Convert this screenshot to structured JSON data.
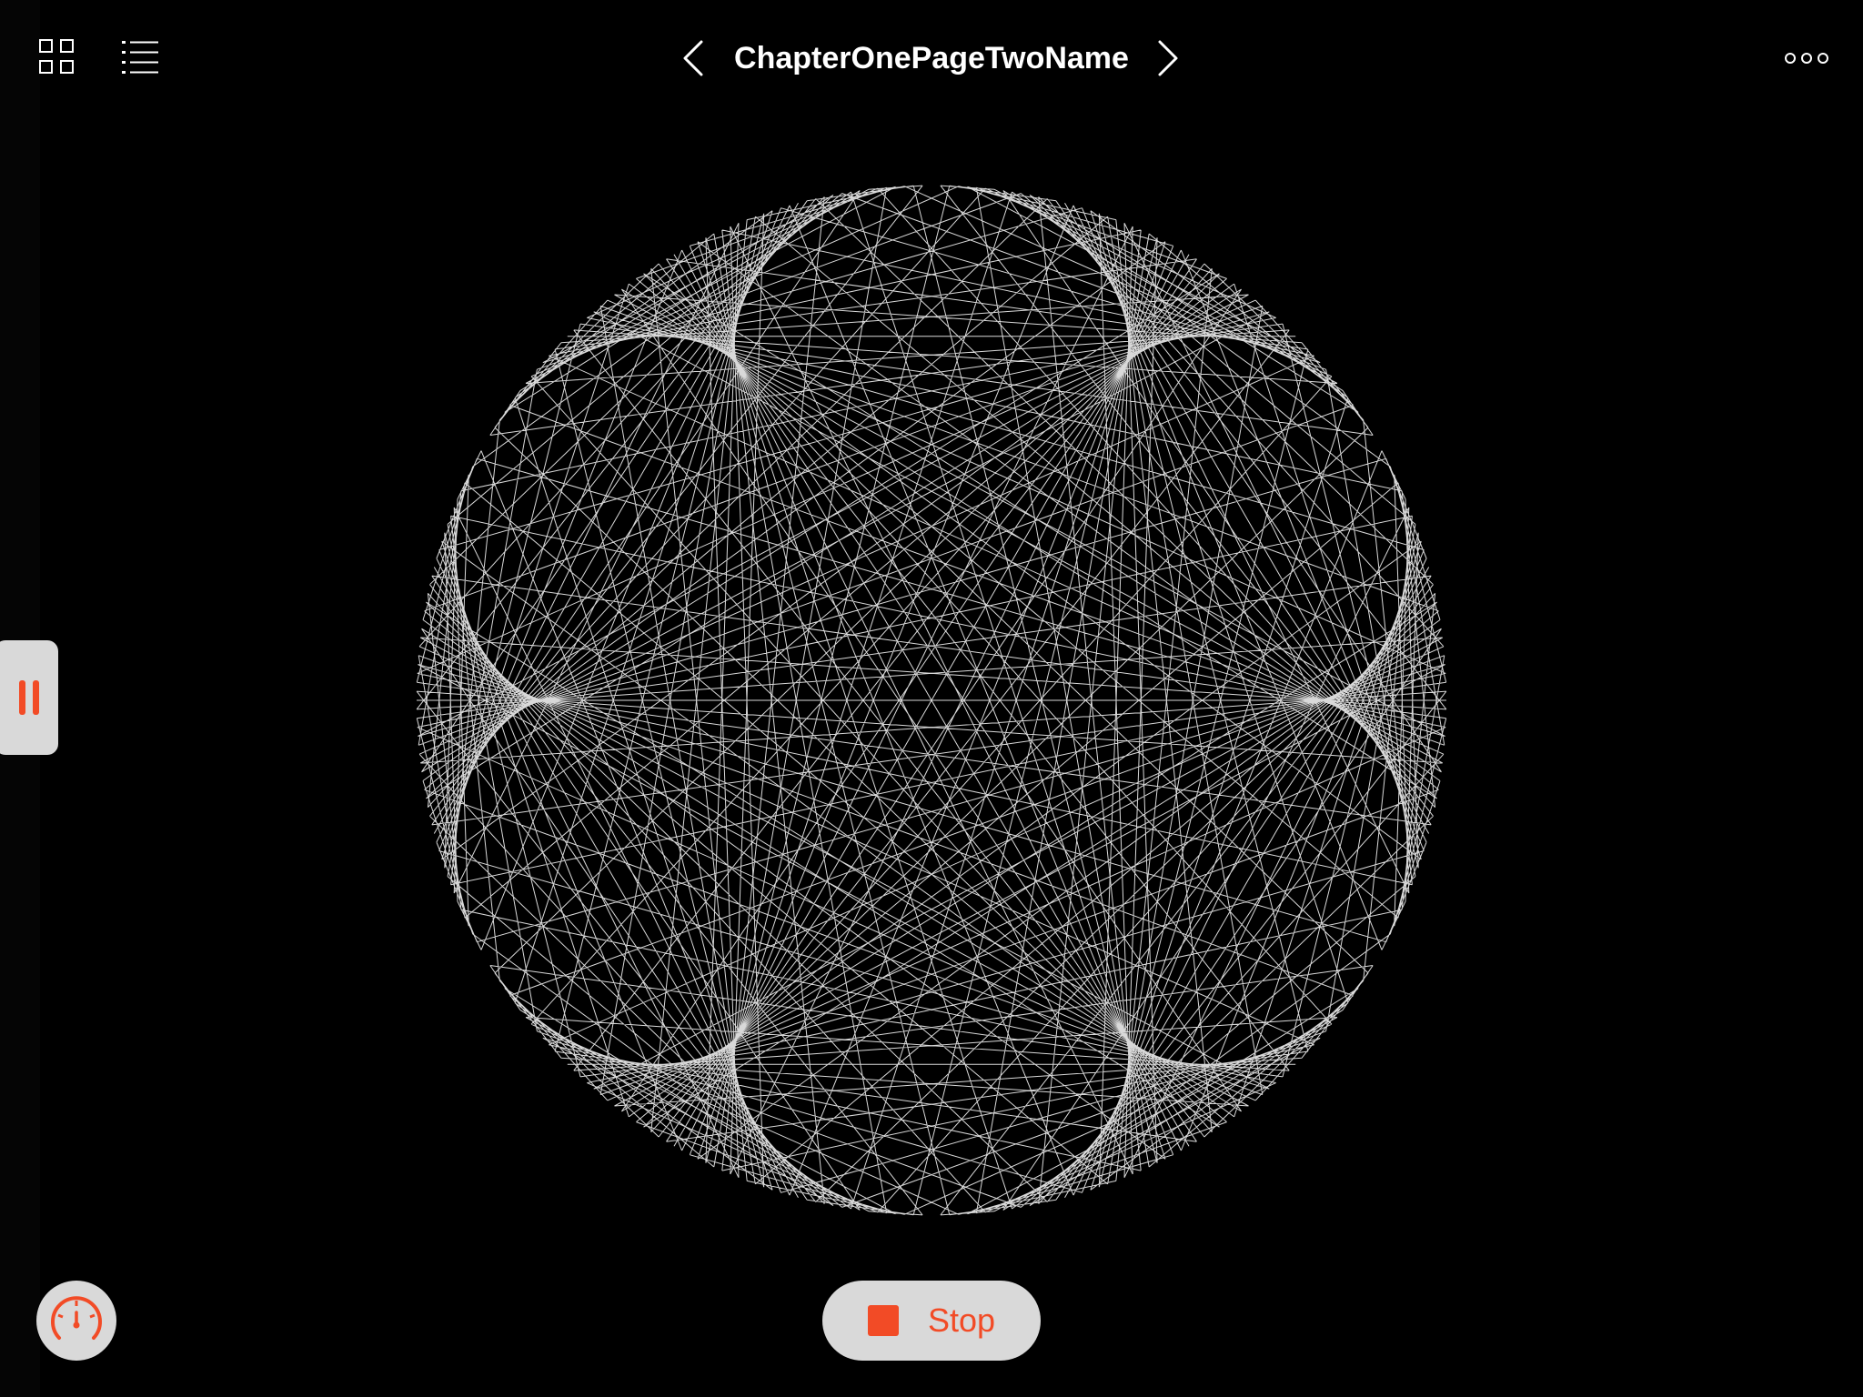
{
  "toolbar": {
    "title": "ChapterOnePageTwoName",
    "grid_icon": "grid-icon",
    "list_icon": "list-icon",
    "prev_icon": "chevron-left-icon",
    "next_icon": "chevron-right-icon",
    "more_icon": "more-icon"
  },
  "controls": {
    "stop_label": "Stop",
    "stop_icon": "stop-icon",
    "pause_icon": "pause-icon",
    "speed_icon": "speedometer-icon"
  },
  "art": {
    "pattern": "string-art star",
    "line_color": "#ffffff",
    "background": "#000000"
  },
  "colors": {
    "accent": "#f24b26",
    "control_bg": "#d9d9d9",
    "text": "#ffffff"
  }
}
